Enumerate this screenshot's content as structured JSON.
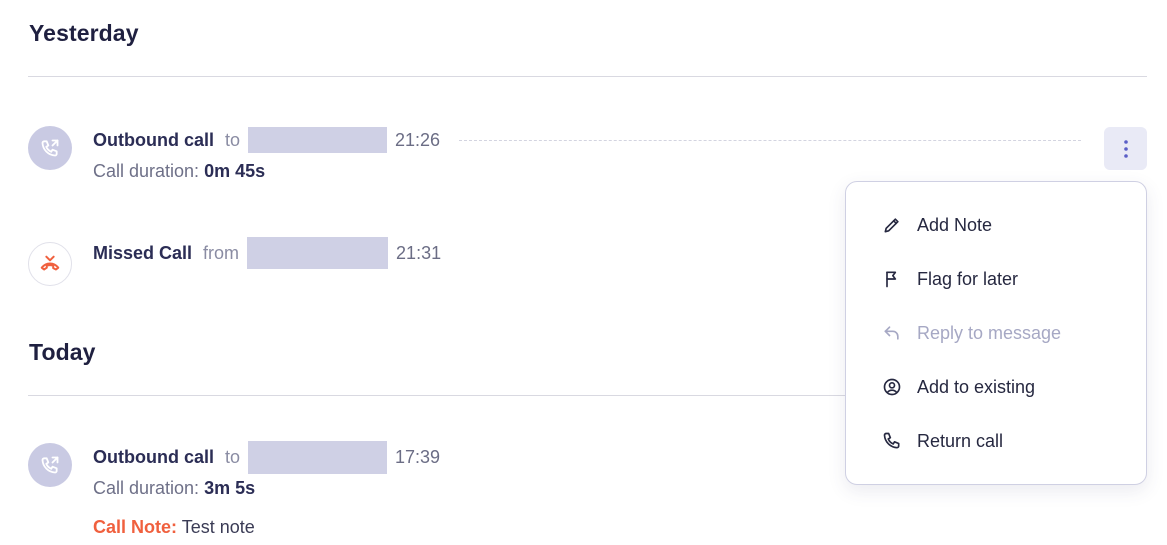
{
  "sections": {
    "yesterday": {
      "title": "Yesterday"
    },
    "today": {
      "title": "Today"
    }
  },
  "calls": [
    {
      "type": "Outbound call",
      "direction": "to",
      "time": "21:26",
      "duration_label": "Call duration:",
      "duration_value": "0m 45s",
      "icon": "phone-outgoing-icon"
    },
    {
      "type": "Missed Call",
      "direction": "from",
      "time": "21:31",
      "icon": "phone-missed-icon"
    },
    {
      "type": "Outbound call",
      "direction": "to",
      "time": "17:39",
      "duration_label": "Call duration:",
      "duration_value": "3m 5s",
      "note_label": "Call Note:",
      "note_text": "Test note",
      "icon": "phone-outgoing-icon"
    }
  ],
  "menu": {
    "items": [
      {
        "label": "Add Note",
        "icon": "pencil-icon",
        "disabled": false
      },
      {
        "label": "Flag for later",
        "icon": "flag-icon",
        "disabled": false
      },
      {
        "label": "Reply to message",
        "icon": "reply-icon",
        "disabled": true
      },
      {
        "label": "Add to existing",
        "icon": "user-circle-icon",
        "disabled": false
      },
      {
        "label": "Return call",
        "icon": "phone-icon",
        "disabled": false
      }
    ]
  },
  "colors": {
    "accent": "#5b5fc7",
    "avatar_bg": "#c9cae3",
    "redacted": "#cfd0e5",
    "missed": "#f0603e",
    "note_label": "#f0603e",
    "disabled_text": "#a6a8c4"
  }
}
